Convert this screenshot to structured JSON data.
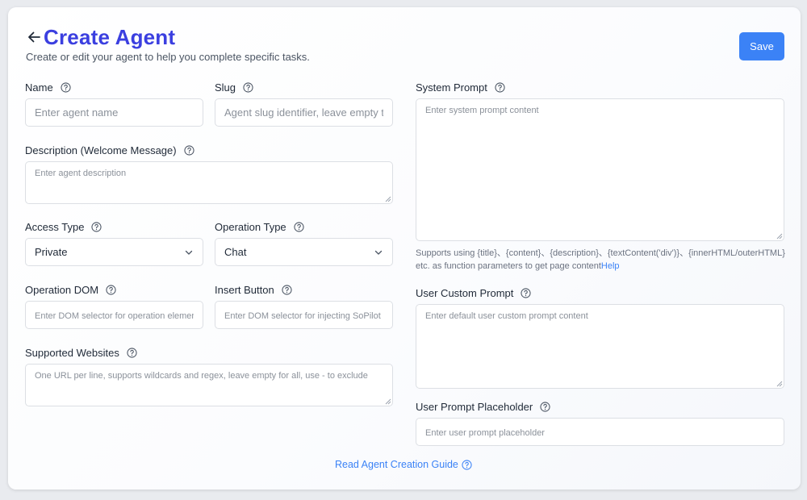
{
  "header": {
    "title": "Create Agent",
    "subtitle": "Create or edit your agent to help you complete specific tasks.",
    "save_label": "Save"
  },
  "form": {
    "name": {
      "label": "Name",
      "placeholder": "Enter agent name",
      "value": ""
    },
    "slug": {
      "label": "Slug",
      "placeholder": "Agent slug identifier, leave empty t",
      "value": ""
    },
    "description": {
      "label": "Description (Welcome Message)",
      "placeholder": "Enter agent description",
      "value": ""
    },
    "access_type": {
      "label": "Access Type",
      "selected": "Private"
    },
    "operation_type": {
      "label": "Operation Type",
      "selected": "Chat"
    },
    "operation_dom": {
      "label": "Operation DOM",
      "placeholder": "Enter DOM selector for operation elemer",
      "value": ""
    },
    "insert_button": {
      "label": "Insert Button",
      "placeholder": "Enter DOM selector for injecting SoPilot I",
      "value": ""
    },
    "supported_websites": {
      "label": "Supported Websites",
      "placeholder": "One URL per line, supports wildcards and regex, leave empty for all, use - to exclude",
      "value": ""
    },
    "system_prompt": {
      "label": "System Prompt",
      "placeholder": "Enter system prompt content",
      "value": "",
      "hint": "Supports using {title}、{content}、{description}、{textContent('div')}、{innerHTML/outerHTML} etc. as function parameters to get page content",
      "hint_link": "Help"
    },
    "user_custom_prompt": {
      "label": "User Custom Prompt",
      "placeholder": "Enter default user custom prompt content",
      "value": ""
    },
    "user_prompt_placeholder": {
      "label": "User Prompt Placeholder",
      "placeholder": "Enter user prompt placeholder",
      "value": ""
    }
  },
  "footer": {
    "guide_link": "Read Agent Creation Guide"
  },
  "colors": {
    "accent": "#3b3fe0",
    "button": "#3b82f6",
    "link": "#3b82f6"
  },
  "icons": {
    "back": "arrow-left-icon",
    "help": "question-circle-icon",
    "dropdown": "chevron-down-icon",
    "resize": "resize-handle-icon"
  }
}
